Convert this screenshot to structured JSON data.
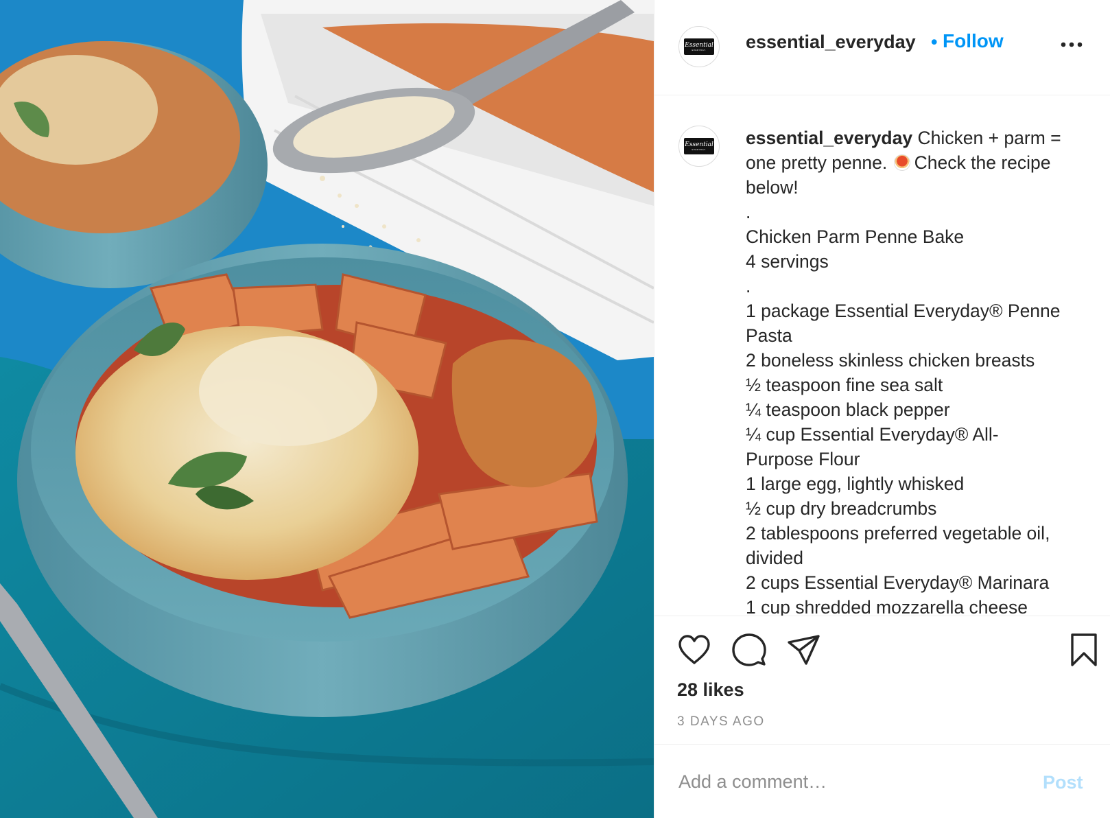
{
  "post": {
    "username": "essential_everyday",
    "avatar": {
      "logo_script": "Essential",
      "logo_sub": "EVERYDAY."
    },
    "follow_dot": "•",
    "follow_label": "Follow",
    "more_icon": "more-horizontal-icon",
    "photo_alt": "chicken-parm-penne-bowl-photo"
  },
  "caption": {
    "username": "essential_everyday",
    "lines": [
      "Chicken + parm =",
      "one pretty penne.",
      "Check the recipe",
      "below!",
      ".",
      "Chicken Parm Penne Bake",
      "4 servings",
      ".",
      "1 package Essential Everyday® Penne",
      "Pasta",
      "2 boneless skinless chicken breasts",
      "½ teaspoon fine sea salt",
      "¼ teaspoon black pepper",
      "¼ cup Essential Everyday® All-",
      "Purpose Flour",
      "1 large egg, lightly whisked",
      "½ cup dry breadcrumbs",
      "2 tablespoons preferred vegetable oil,",
      "divided",
      "2 cups Essential Everyday® Marinara",
      "1 cup shredded mozzarella cheese"
    ],
    "emoji": "spaghetti-emoji"
  },
  "actions": {
    "like_icon": "heart-icon",
    "comment_icon": "comment-icon",
    "share_icon": "paper-plane-icon",
    "save_icon": "bookmark-icon",
    "likes_text": "28 likes",
    "time_text": "3 DAYS AGO"
  },
  "comment": {
    "placeholder": "Add a comment…",
    "post_label": "Post"
  },
  "colors": {
    "accent": "#0095f6",
    "post_disabled": "#b2dffc",
    "text": "#262626",
    "muted": "#8e8e8e",
    "divider": "#efefef"
  }
}
